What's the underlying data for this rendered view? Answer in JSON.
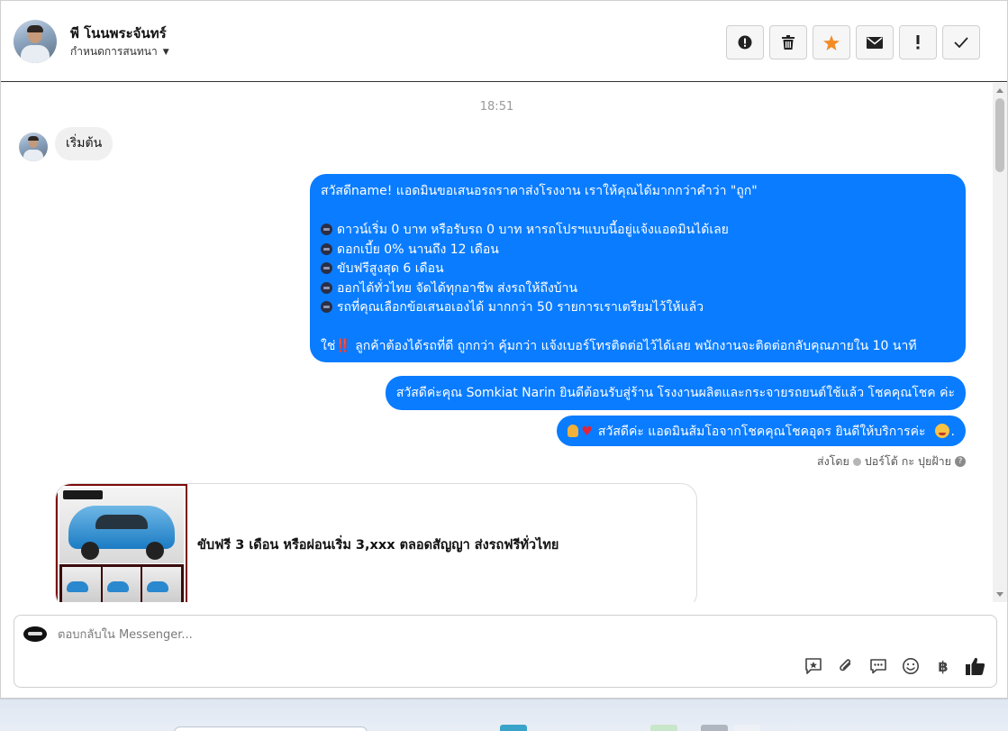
{
  "header": {
    "contact_name": "พี โนนพระจันทร์",
    "assign_label": "กำหนดการสนทนา",
    "toolbar": [
      {
        "icon": "alert-circle-icon"
      },
      {
        "icon": "trash-icon"
      },
      {
        "icon": "star-icon"
      },
      {
        "icon": "envelope-icon"
      },
      {
        "icon": "exclamation-icon"
      },
      {
        "icon": "checkmark-icon"
      }
    ]
  },
  "conversation": {
    "timestamp": "18:51",
    "incoming": [
      {
        "text": "เริ่มต้น"
      }
    ],
    "outgoing": [
      {
        "lines": [
          "สวัสดีname! แอดมินขอเสนอรถราคาส่งโรงงาน เราให้คุณได้มากกว่าคำว่า \"ถูก\"",
          "",
          "ดาวน์เริ่ม 0 บาท หรือรับรถ 0 บาท หารถโปรฯแบบนี้อยู่แจ้งแอดมินได้เลย",
          "ดอกเบี้ย 0% นานถึง 12 เดือน",
          "ขับฟรีสูงสุด 6 เดือน",
          "ออกได้ทั่วไทย จัดได้ทุกอาชีพ ส่งรถให้ถึงบ้าน",
          "รถที่คุณเลือกข้อเสนอเองได้ มากกว่า 50 รายการเราเตรียมไว้ให้แล้ว",
          "",
          "ใช่‼️ ลูกค้าต้องได้รถที่ดี ถูกกว่า คุ้มกว่า แจ้งเบอร์โทรติดต่อไว้ได้เลย พนักงานจะติดต่อกลับคุณภายใน 10 นาที"
        ]
      },
      {
        "text": "สวัสดีค่ะคุณ Somkiat Narin ยินดีต้อนรับสู่ร้าน โรงงานผลิตและกระจายรถยนต์ใช้แล้ว โชคคุณโชค ค่ะ"
      },
      {
        "text": "สวัสดีค่ะ แอดมินส้มโอจากโชคคุณโชคอุดร ยินดีให้บริการค่ะ"
      }
    ],
    "sent_by_label": "ส่งโดย",
    "sent_by_name": "ปอร์โต้ กะ ปุยฝ้าย",
    "card": {
      "title": "ขับฟรี 3 เดือน หรือผ่อนเริ่ม 3,xxx ตลอดสัญญา ส่งรถฟรีทั่วไทย"
    }
  },
  "composer": {
    "placeholder": "ตอบกลับใน Messenger...",
    "baht_symbol": "฿",
    "tools": [
      "saved-reply-icon",
      "attachment-icon",
      "chat-bubbles-icon",
      "emoji-icon",
      "baht-icon",
      "thumbs-up-icon"
    ]
  },
  "colors": {
    "outgoing_bubble": "#0a7cff",
    "incoming_bubble": "#f0f0f0",
    "star": "#f28c28"
  }
}
